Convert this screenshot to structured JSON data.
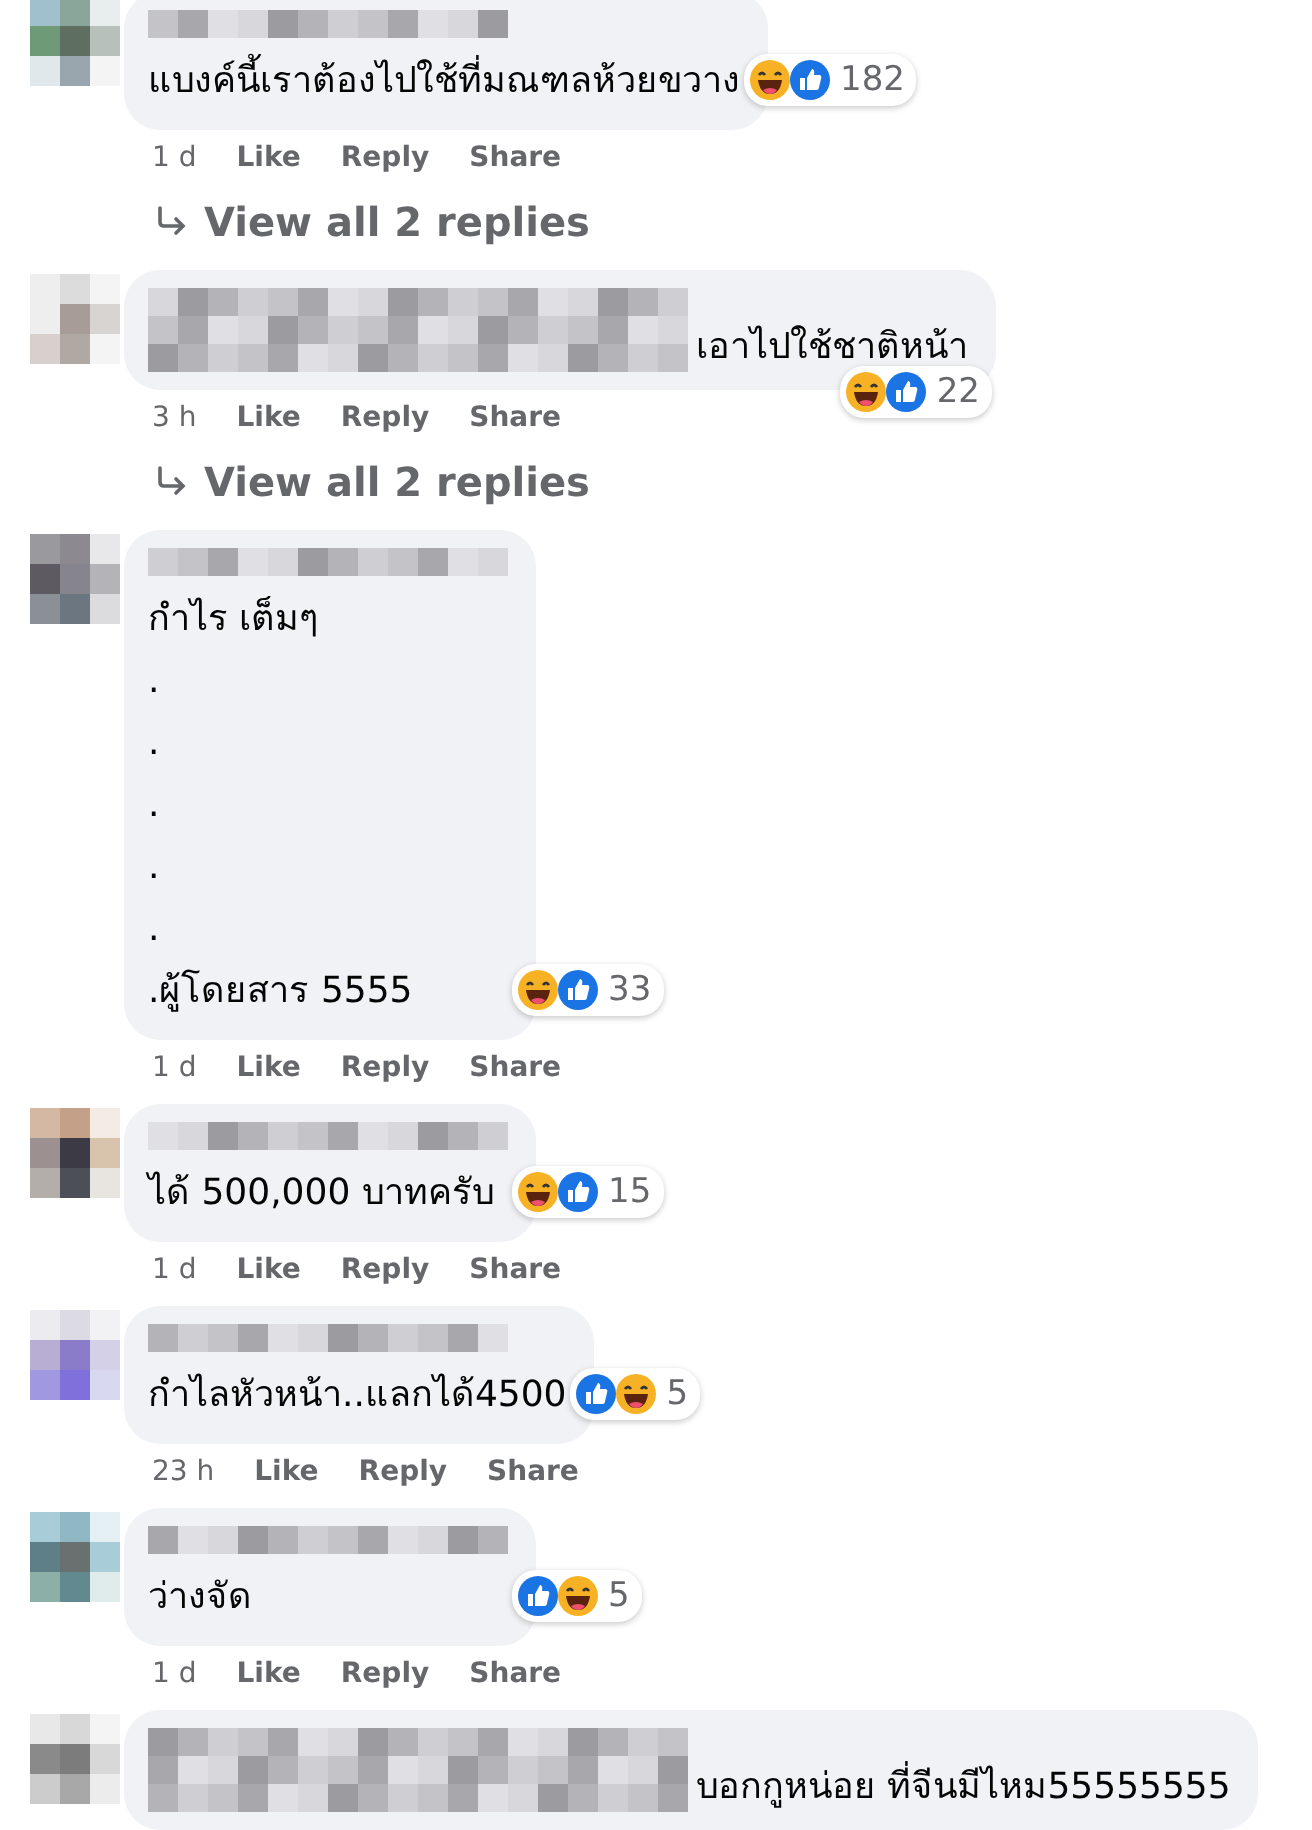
{
  "comments": [
    {
      "kind": "name-above",
      "text_lines": [
        "แบงค์นี้เราต้องไปใช้ที่มณฑลห้วยขวาง"
      ],
      "reactions": [
        {
          "kind": "haha"
        },
        {
          "kind": "like"
        }
      ],
      "reaction_count": "182",
      "time": "1 d",
      "actions": [
        "Like",
        "Reply",
        "Share"
      ],
      "replies_link": "View all 2 replies"
    },
    {
      "kind": "name-inline",
      "text_lines": [
        "เอาไปใช้ชาติหน้า"
      ],
      "reactions": [
        {
          "kind": "haha"
        },
        {
          "kind": "like"
        }
      ],
      "reaction_count": "22",
      "time": "3 h",
      "actions": [
        "Like",
        "Reply",
        "Share"
      ],
      "replies_link": "View all 2 replies"
    },
    {
      "kind": "name-above",
      "text_lines": [
        "กำไร เต็มๆ",
        ".",
        ".",
        ".",
        ".",
        ".",
        ".ผู้โดยสาร 5555"
      ],
      "reactions": [
        {
          "kind": "haha"
        },
        {
          "kind": "like"
        }
      ],
      "reaction_count": "33",
      "time": "1 d",
      "actions": [
        "Like",
        "Reply",
        "Share"
      ]
    },
    {
      "kind": "name-above",
      "text_lines": [
        "ได้ 500,000 บาทครับ"
      ],
      "reactions": [
        {
          "kind": "haha"
        },
        {
          "kind": "like"
        }
      ],
      "reaction_count": "15",
      "time": "1 d",
      "actions": [
        "Like",
        "Reply",
        "Share"
      ]
    },
    {
      "kind": "name-above",
      "text_lines": [
        "กำไลหัวหน้า..แลกได้4500"
      ],
      "reactions": [
        {
          "kind": "like"
        },
        {
          "kind": "haha"
        }
      ],
      "reaction_count": "5",
      "time": "23 h",
      "actions": [
        "Like",
        "Reply",
        "Share"
      ]
    },
    {
      "kind": "name-above",
      "text_lines": [
        "ว่างจัด"
      ],
      "reactions": [
        {
          "kind": "like"
        },
        {
          "kind": "haha"
        }
      ],
      "reaction_count": "5",
      "time": "1 d",
      "actions": [
        "Like",
        "Reply",
        "Share"
      ]
    },
    {
      "kind": "name-inline",
      "text_lines": [
        "บอกกูหน่อย ที่จีนมีไหม55555555"
      ]
    }
  ]
}
